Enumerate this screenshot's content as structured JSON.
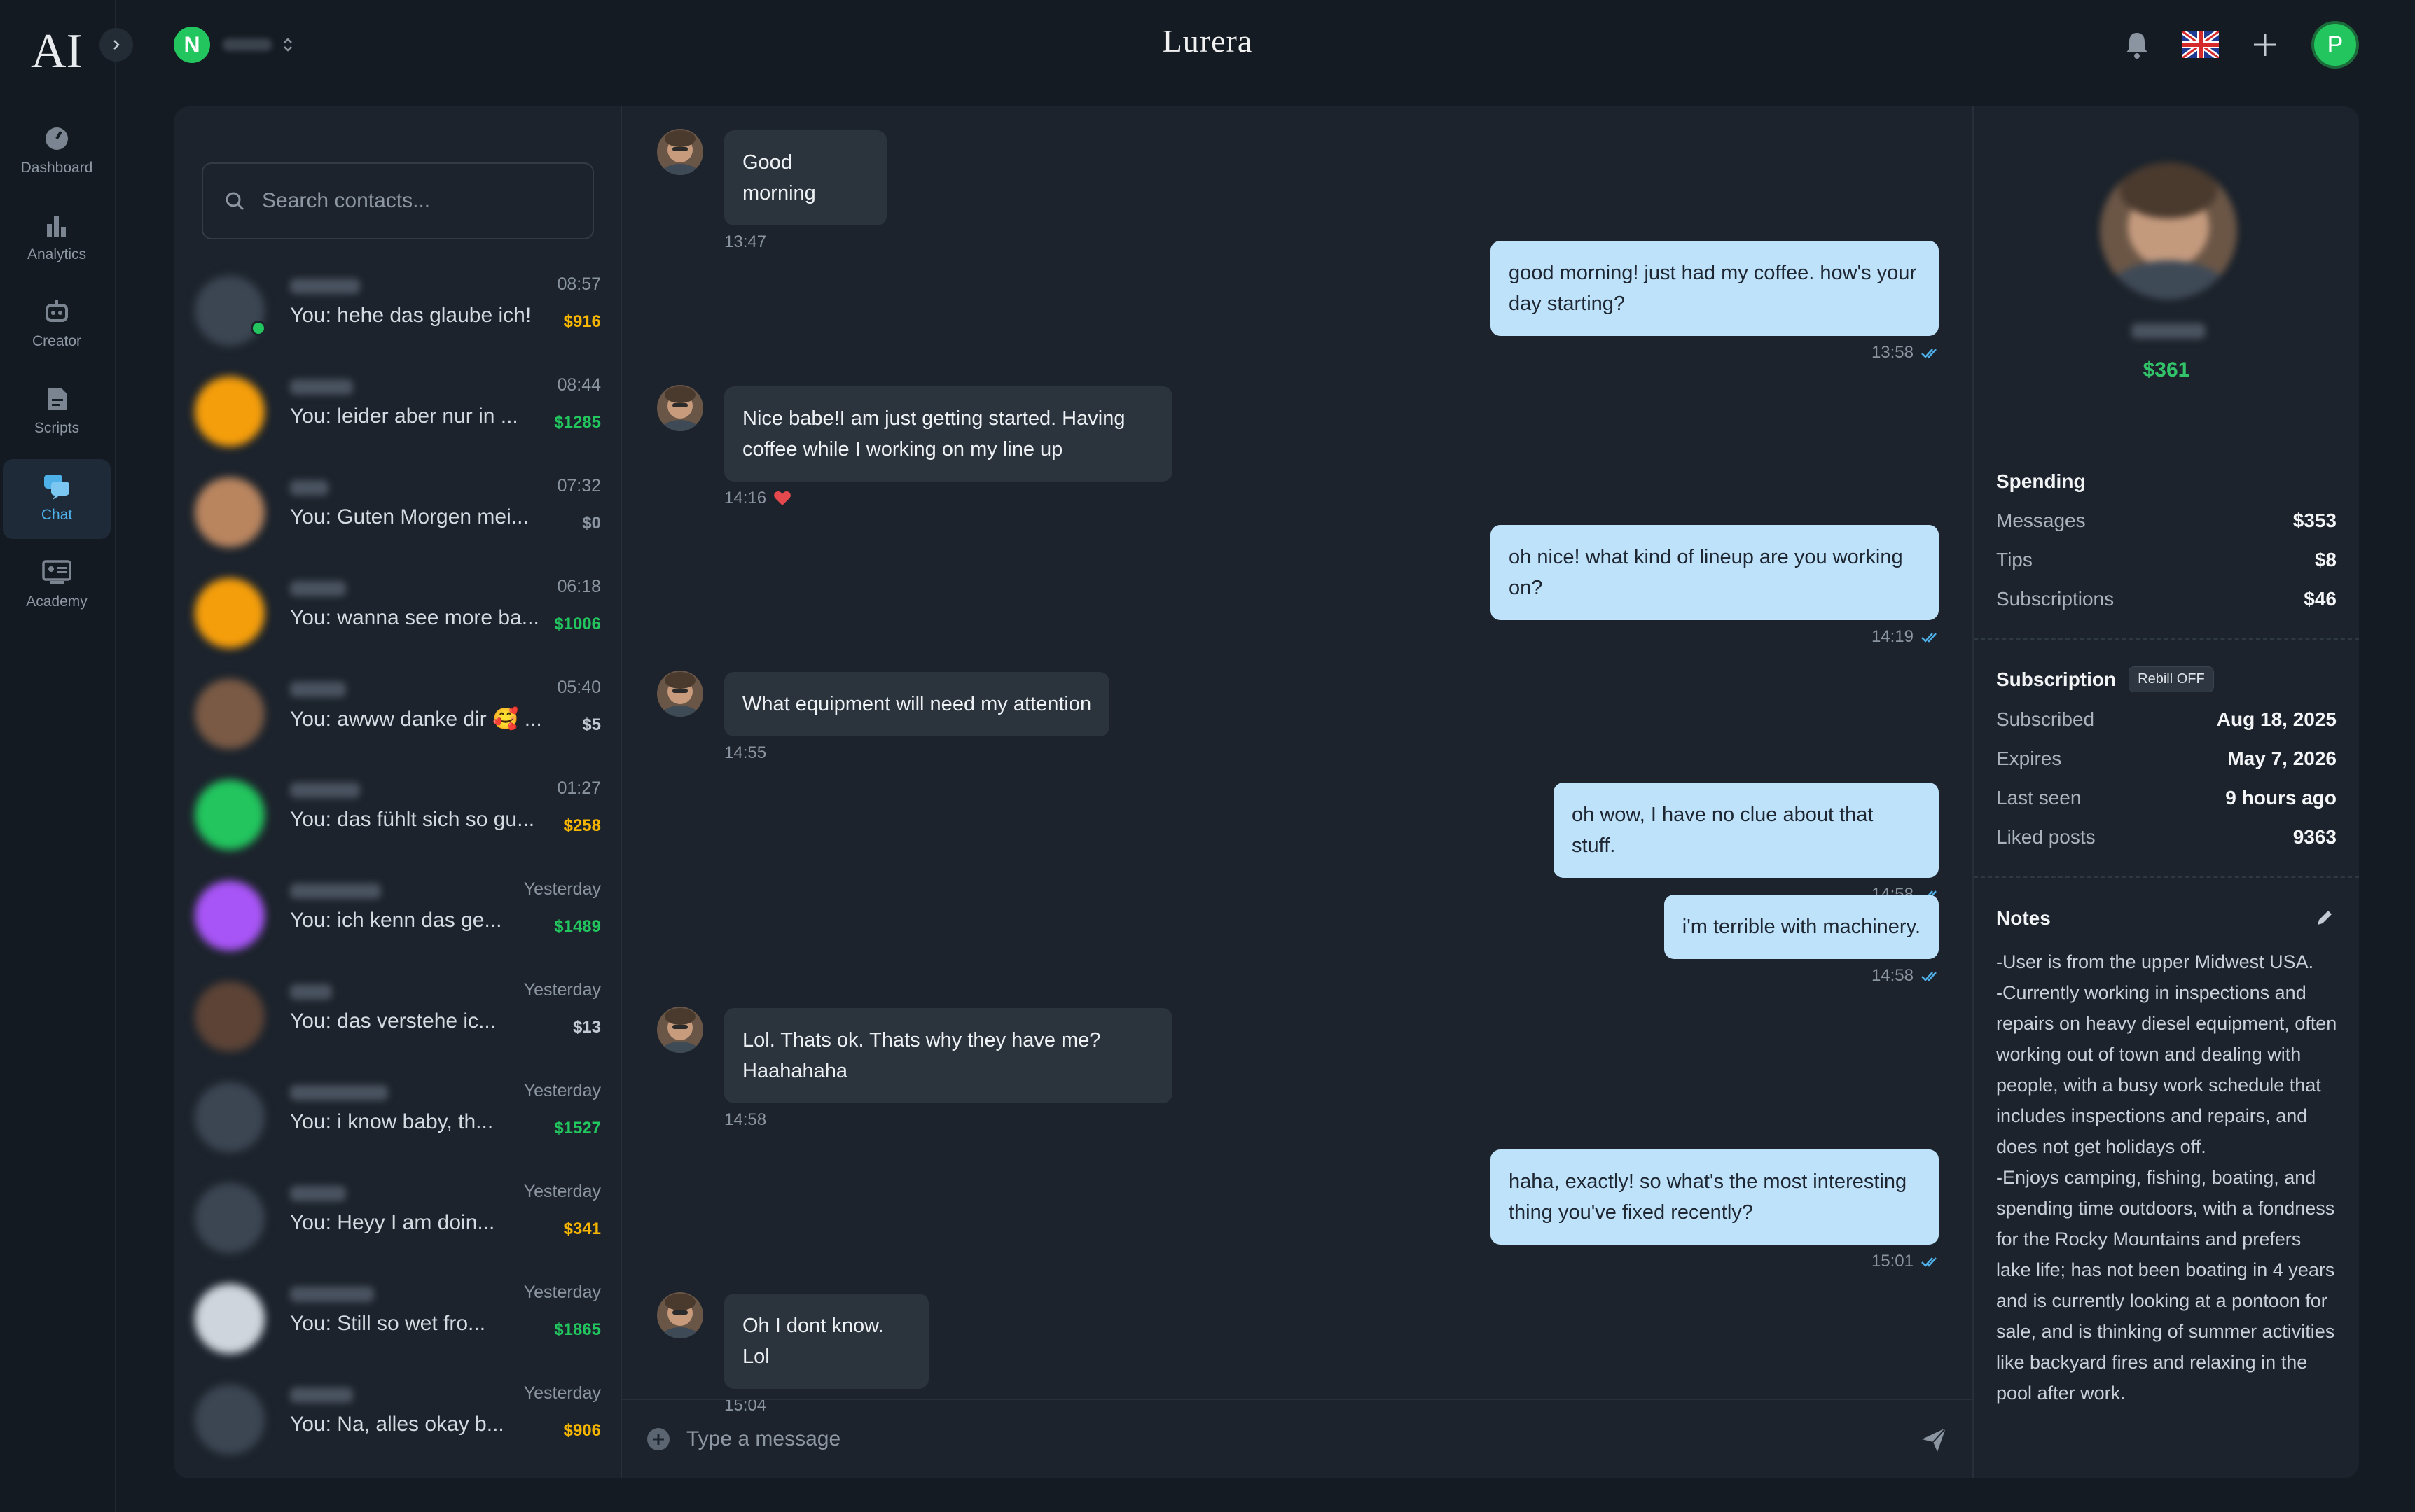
{
  "app": {
    "brand": "Lurera",
    "logo_text": "AI"
  },
  "topbar": {
    "workspace_initial": "N",
    "user_initial": "P",
    "icons": [
      "chevron-right-icon",
      "bell-icon",
      "uk-flag-icon",
      "plus-icon"
    ]
  },
  "nav": {
    "items": [
      {
        "label": "Dashboard",
        "icon": "dashboard-icon"
      },
      {
        "label": "Analytics",
        "icon": "bar-chart-icon"
      },
      {
        "label": "Creator",
        "icon": "robot-icon"
      },
      {
        "label": "Scripts",
        "icon": "document-icon"
      },
      {
        "label": "Chat",
        "icon": "chat-icon",
        "active": true
      },
      {
        "label": "Academy",
        "icon": "academy-icon"
      }
    ]
  },
  "contacts": {
    "search_placeholder": "Search contacts...",
    "list": [
      {
        "last": "You: hehe das glaube ich!",
        "time": "08:57",
        "amount": "$916",
        "amount_color": "#f5b400",
        "online": true
      },
      {
        "last": "You: leider aber nur in ...",
        "time": "08:44",
        "amount": "$1285",
        "amount_color": "#22c55e"
      },
      {
        "last": "You: Guten Morgen mei...",
        "time": "07:32",
        "amount": "$0",
        "amount_color": "#8b95a1"
      },
      {
        "last": "You: wanna see more ba...",
        "time": "06:18",
        "amount": "$1006",
        "amount_color": "#22c55e"
      },
      {
        "last": "You: awww danke dir 🥰 ...",
        "time": "05:40",
        "amount": "$5",
        "amount_color": "#c3cad2"
      },
      {
        "last": "You: das fühlt sich so gu...",
        "time": "01:27",
        "amount": "$258",
        "amount_color": "#f5b400"
      },
      {
        "last": "You: ich kenn das ge...",
        "time": "Yesterday",
        "amount": "$1489",
        "amount_color": "#22c55e"
      },
      {
        "last": "You: das verstehe ic...",
        "time": "Yesterday",
        "amount": "$13",
        "amount_color": "#c3cad2"
      },
      {
        "last": "You: i know baby, th...",
        "time": "Yesterday",
        "amount": "$1527",
        "amount_color": "#22c55e"
      },
      {
        "last": "You: Heyy I am doin...",
        "time": "Yesterday",
        "amount": "$341",
        "amount_color": "#f5b400"
      },
      {
        "last": "You: Still so wet fro...",
        "time": "Yesterday",
        "amount": "$1865",
        "amount_color": "#22c55e"
      },
      {
        "last": "You: Na, alles okay b...",
        "time": "Yesterday",
        "amount": "$906",
        "amount_color": "#f5b400"
      }
    ]
  },
  "chat": {
    "messages": [
      {
        "dir": "in",
        "text": "Good morning",
        "time": "13:47"
      },
      {
        "dir": "out",
        "text": "good morning! just had my coffee. how's your day starting?",
        "time": "13:58"
      },
      {
        "dir": "in",
        "text": "Nice babe!I am just getting started. Having coffee while I working on my line up",
        "time": "14:16",
        "reaction": "heart-icon"
      },
      {
        "dir": "out",
        "text": "oh nice! what kind of lineup are you working on?",
        "time": "14:19"
      },
      {
        "dir": "in",
        "text": "What equipment will need my attention",
        "time": "14:55"
      },
      {
        "dir": "out",
        "text": "oh wow, I have no clue about that stuff.",
        "time": "14:58"
      },
      {
        "dir": "out",
        "text": "i'm terrible with machinery.",
        "time": "14:58"
      },
      {
        "dir": "in",
        "text": "Lol. Thats ok. Thats why they have me? Haahahaha",
        "time": "14:58"
      },
      {
        "dir": "out",
        "text": "haha, exactly! so what's the most interesting thing you've fixed recently?",
        "time": "15:01"
      },
      {
        "dir": "in",
        "text": "Oh I dont know. Lol",
        "time": "15:04"
      }
    ],
    "composer_placeholder": "Type a message"
  },
  "profile": {
    "total": "$361",
    "spending": {
      "title": "Spending",
      "rows": [
        {
          "label": "Messages",
          "value": "$353"
        },
        {
          "label": "Tips",
          "value": "$8"
        },
        {
          "label": "Subscriptions",
          "value": "$46"
        }
      ]
    },
    "subscription": {
      "title": "Subscription",
      "badge": "Rebill OFF",
      "rows": [
        {
          "label": "Subscribed",
          "value": "Aug 18, 2025"
        },
        {
          "label": "Expires",
          "value": "May 7, 2026"
        },
        {
          "label": "Last seen",
          "value": "9 hours ago"
        },
        {
          "label": "Liked posts",
          "value": "9363"
        }
      ]
    },
    "notes": {
      "title": "Notes",
      "body": "-User is from the upper Midwest USA.\n-Currently working in inspections and repairs on heavy diesel equipment, often working out of town and dealing with people, with a busy work schedule that includes inspections and repairs, and does not get holidays off.\n-Enjoys camping, fishing, boating, and spending time outdoors, with a fondness for the Rocky Mountains and prefers lake life; has not been boating in 4 years and is currently looking at a pontoon for sale, and is thinking of summer activities like backyard fires and relaxing in the pool after work."
    }
  },
  "colors": {
    "accent": "#4fb1ea",
    "green": "#22c55e",
    "amber": "#f5b400",
    "bubble_out": "#bfe2fb",
    "bubble_in": "#2b333d"
  }
}
